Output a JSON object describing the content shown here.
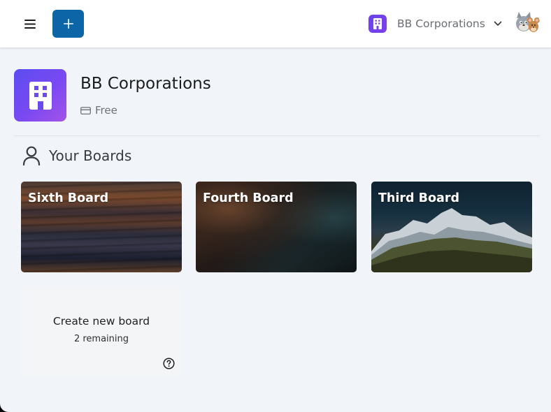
{
  "header": {
    "workspace_name": "BB Corporations"
  },
  "workspace": {
    "title": "BB Corporations",
    "plan": "Free"
  },
  "boards_section": {
    "title": "Your Boards",
    "boards": [
      {
        "label": "Sixth Board"
      },
      {
        "label": "Fourth Board"
      },
      {
        "label": "Third Board"
      }
    ],
    "create": {
      "label": "Create new board",
      "remaining": "2 remaining"
    }
  },
  "colors": {
    "accent": "#0b65a7",
    "workspace_gradient_start": "#5b4df0",
    "workspace_gradient_end": "#a453e8",
    "background": "#f1f4f9"
  },
  "icons": {
    "menu": "hamburger-icon",
    "add": "plus-icon",
    "workspace": "building-icon",
    "chevron": "chevron-down-icon",
    "plan": "credit-card-icon",
    "section": "user-icon",
    "help": "help-circle-icon"
  }
}
